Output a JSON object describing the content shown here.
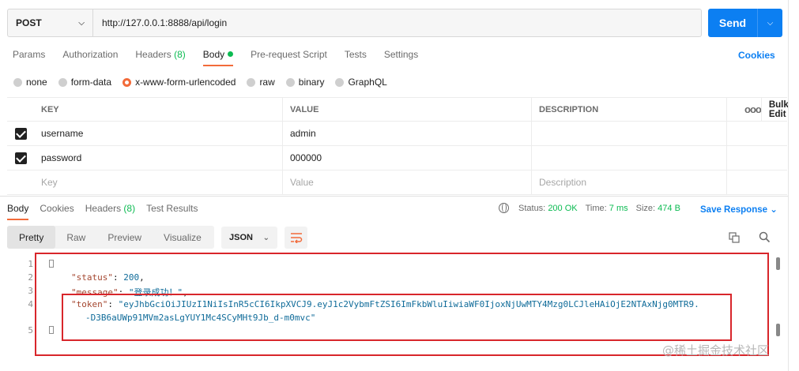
{
  "request": {
    "method": "POST",
    "url": "http://127.0.0.1:8888/api/login",
    "send_label": "Send"
  },
  "req_tabs": {
    "params": "Params",
    "authorization": "Authorization",
    "headers": "Headers",
    "headers_count": "(8)",
    "body": "Body",
    "pre_request": "Pre-request Script",
    "tests": "Tests",
    "settings": "Settings",
    "cookies": "Cookies"
  },
  "body_types": [
    "none",
    "form-data",
    "x-www-form-urlencoded",
    "raw",
    "binary",
    "GraphQL"
  ],
  "kv_table": {
    "headers": [
      "KEY",
      "VALUE",
      "DESCRIPTION"
    ],
    "bulk_edit": "Bulk Edit",
    "more": "ooo",
    "rows": [
      {
        "key": "username",
        "value": "admin",
        "description": ""
      },
      {
        "key": "password",
        "value": "000000",
        "description": ""
      }
    ],
    "placeholders": {
      "key": "Key",
      "value": "Value",
      "description": "Description"
    }
  },
  "resp_tabs": {
    "body": "Body",
    "cookies": "Cookies",
    "headers": "Headers",
    "headers_count": "(8)",
    "tests": "Test Results"
  },
  "status": {
    "status_label": "Status:",
    "status_value": "200 OK",
    "time_label": "Time:",
    "time_value": "7 ms",
    "size_label": "Size:",
    "size_value": "474 B",
    "save": "Save Response"
  },
  "toolbar": {
    "formats": [
      "Pretty",
      "Raw",
      "Preview",
      "Visualize"
    ],
    "json": "JSON"
  },
  "code": {
    "line_numbers": [
      "1",
      "2",
      "3",
      "4",
      "",
      "5"
    ],
    "status_key": "\"status\"",
    "status_value": "200",
    "message_key": "\"message\"",
    "message_value": "\"登录成功！\"",
    "token_key": "\"token\"",
    "token_value_1": "\"eyJhbGciOiJIUzI1NiIsInR5cCI6IkpXVCJ9.eyJ1c2VybmFtZSI6ImFkbWluIiwiaWF0IjoxNjUwMTY4Mzg0LCJleHAiOjE2NTAxNjg0MTR9.",
    "token_value_2": "-D3B6aUWp91MVm2asLgYUY1Mc4SCyMHt9Jb_d-m0mvc\""
  },
  "watermark": "@稀土掘金技术社区",
  "colors": {
    "accent": "#0c7ff2",
    "active_tab": "#f26b3a",
    "ok": "#0cbb52",
    "highlight_box": "#d8262b"
  }
}
